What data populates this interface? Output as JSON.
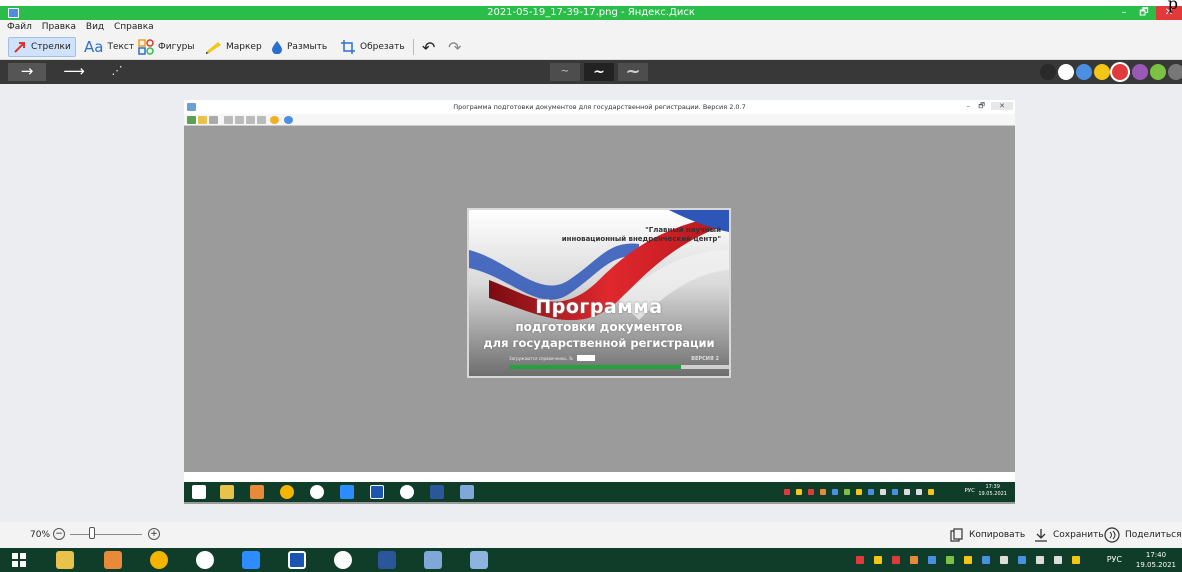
{
  "corner_text": "р",
  "window": {
    "title": "2021-05-19_17-39-17.png - Яндекс.Диск",
    "controls": {
      "minimize": "–",
      "maximize": "🗗",
      "close": "✕"
    }
  },
  "menu": [
    "Файл",
    "Правка",
    "Вид",
    "Справка"
  ],
  "toolbar": {
    "arrows": "Стрелки",
    "text_glyph": "Aa",
    "text": "Текст",
    "shapes": "Фигуры",
    "marker": "Маркер",
    "blur": "Размыть",
    "crop": "Обрезать",
    "undo": "↶",
    "redo": "↷"
  },
  "arrow_styles": [
    "→",
    "⟶",
    "⋰"
  ],
  "stroke_widths": [
    "~",
    "~",
    "~"
  ],
  "colors": [
    "#2a2a2a",
    "#ffffff",
    "#4a90e2",
    "#f5c518",
    "#e03a3a",
    "#9b59b6",
    "#7cc142",
    "#777777"
  ],
  "inner_window": {
    "title": "Программа подготовки документов для государственной регистрации. Версия 2.0.7",
    "controls": {
      "minimize": "–",
      "maximize": "🗗",
      "close": "✕"
    }
  },
  "splash": {
    "org_line1": "\"Главный научный",
    "org_line2": "инновационный внедренческий центр\"",
    "headline1": "Программа",
    "headline2": "подготовки документов",
    "headline3": "для государственной регистрации",
    "loading_label": "Загружаются справочники...",
    "percent_label": "%",
    "version_label": "ВЕРСИЯ 2",
    "progress": 0.78
  },
  "inner_taskbar": {
    "lang": "РУС",
    "time": "17:39",
    "date": "19.05.2021"
  },
  "zoom": {
    "value": "70%",
    "minus": "−",
    "plus": "+",
    "level": 0.3
  },
  "actions": {
    "copy": "Копировать",
    "save": "Сохранить",
    "share": "Поделиться"
  },
  "taskbar": {
    "lang": "РУС",
    "time": "17:40",
    "date": "19.05.2021"
  }
}
